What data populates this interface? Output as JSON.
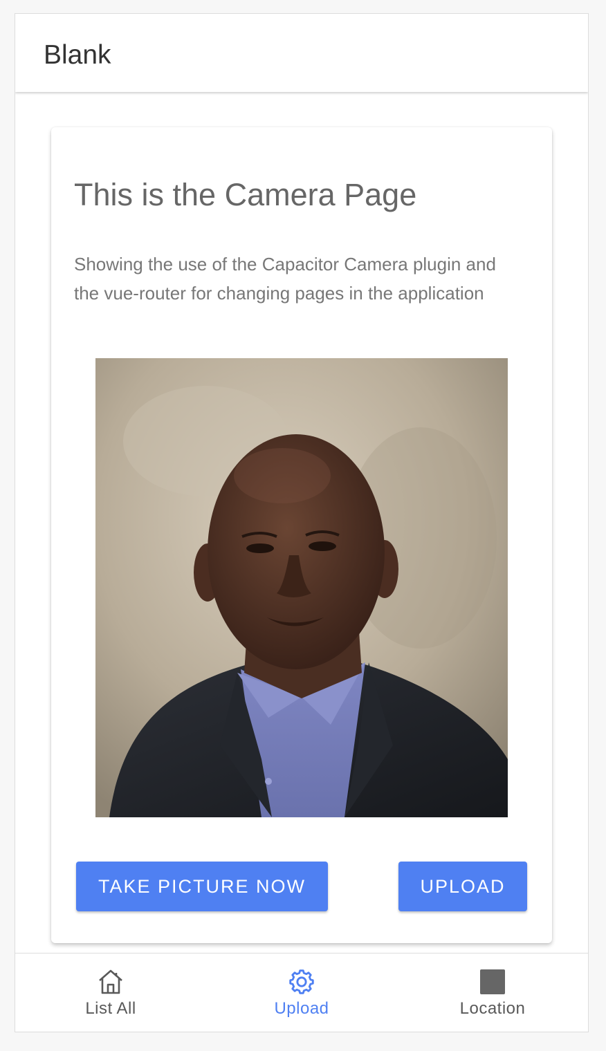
{
  "toolbar": {
    "title": "Blank"
  },
  "card": {
    "title": "This is the Camera Page",
    "description": "Showing the use of the Capacitor Camera plugin and the vue-router for changing pages in the application",
    "photo_icon": "portrait-photo"
  },
  "buttons": {
    "take_picture": "TAKE PICTURE NOW",
    "upload": "UPLOAD"
  },
  "tabs": [
    {
      "label": "List All",
      "icon": "home-icon",
      "active": false
    },
    {
      "label": "Upload",
      "icon": "gear-icon",
      "active": true
    },
    {
      "label": "Location",
      "icon": "square-icon",
      "active": false
    }
  ],
  "colors": {
    "accent": "#4f80f2",
    "tab_inactive": "#595959"
  }
}
